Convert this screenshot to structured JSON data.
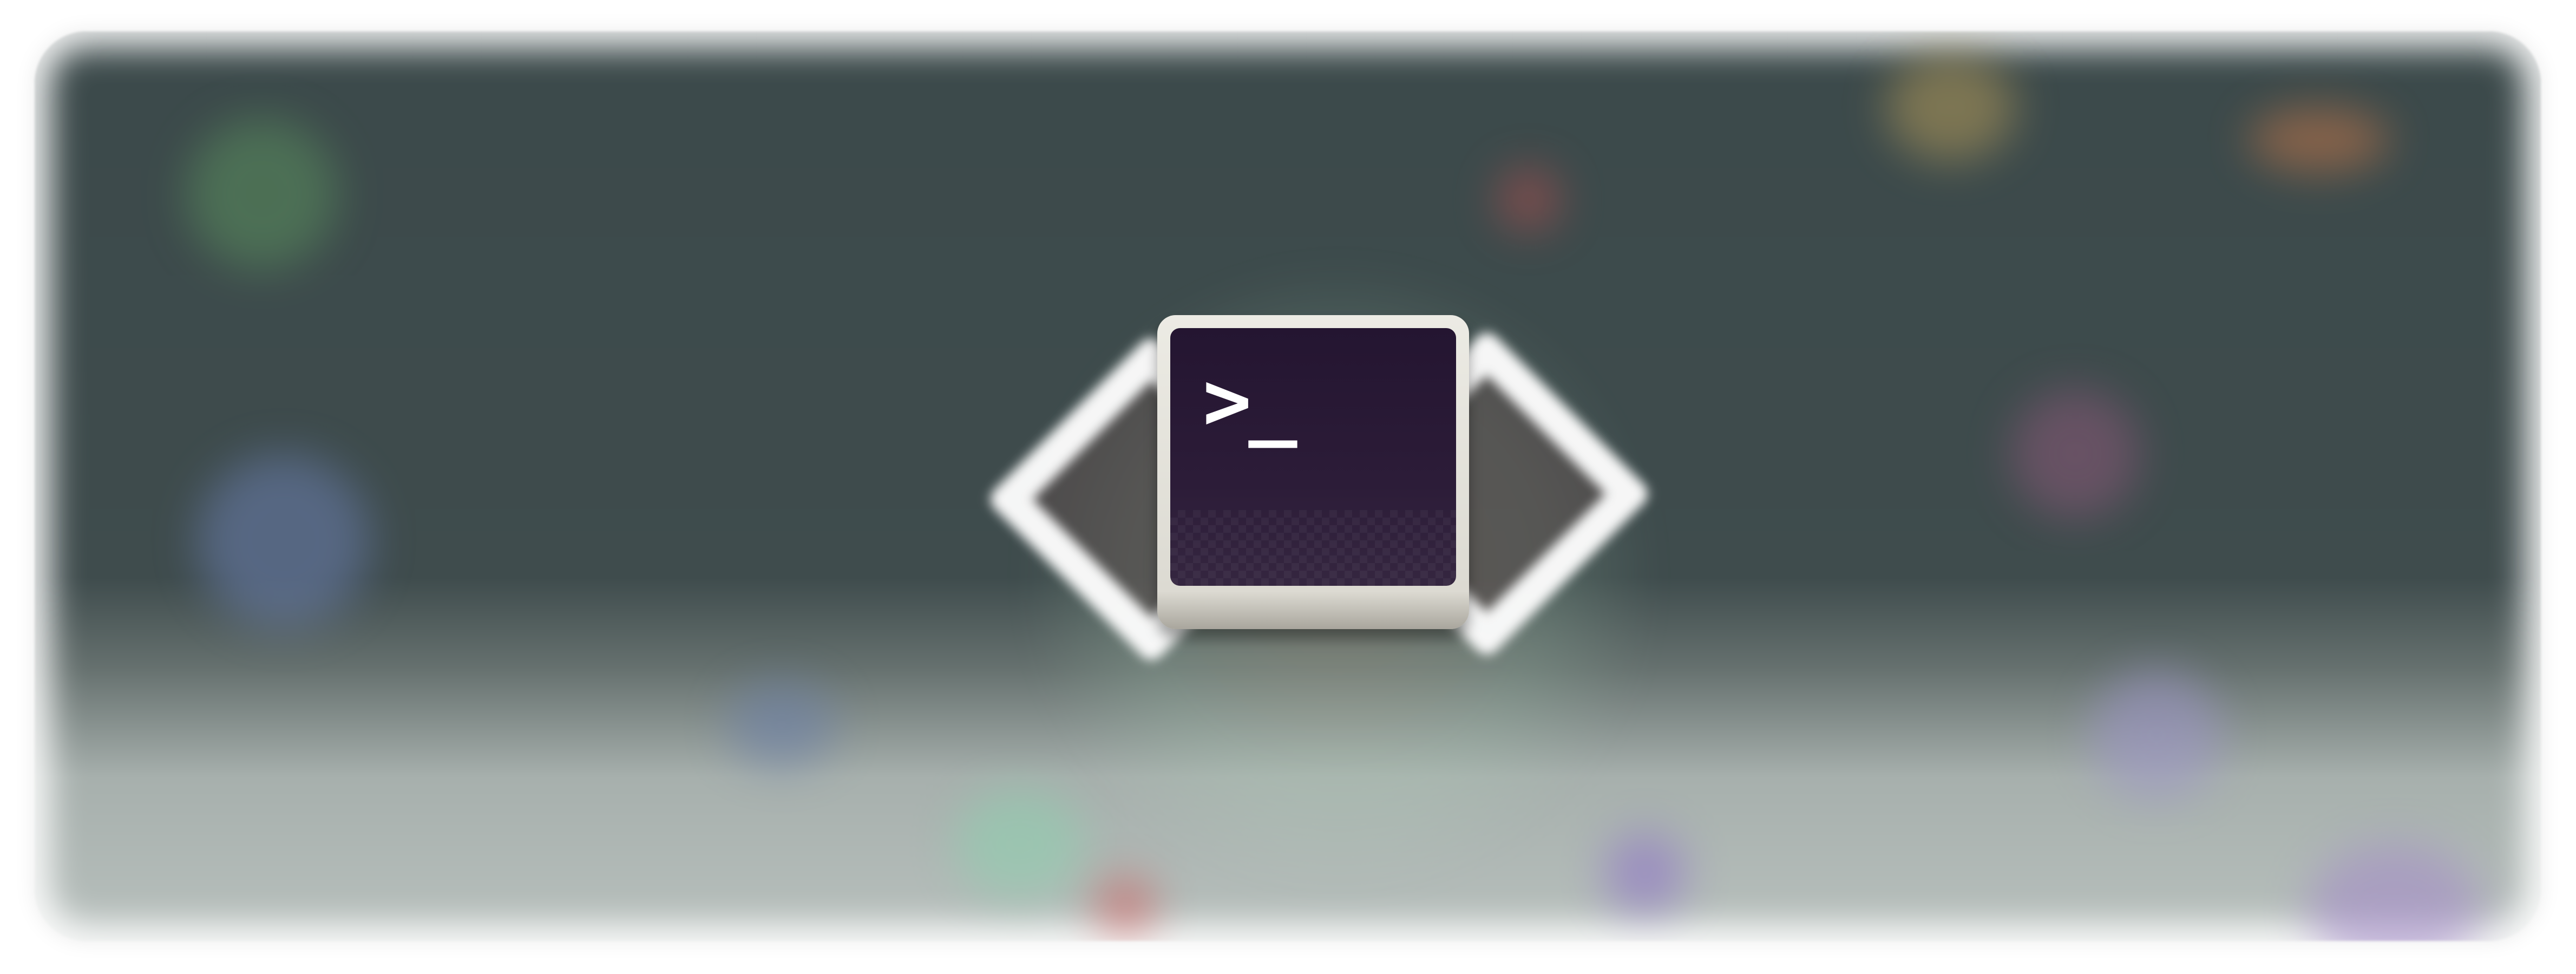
{
  "banner": {
    "icon_name": "terminal-icon",
    "bracket_icon_names": [
      "left-chevron-icon",
      "right-chevron-icon"
    ],
    "prompt_text": ">_",
    "colors": {
      "background_top": "#3c4a4b",
      "background_bottom": "#b8c0bd",
      "terminal_screen": "#241531",
      "terminal_bezel": "#ecebe4",
      "prompt": "#ffffff"
    }
  }
}
